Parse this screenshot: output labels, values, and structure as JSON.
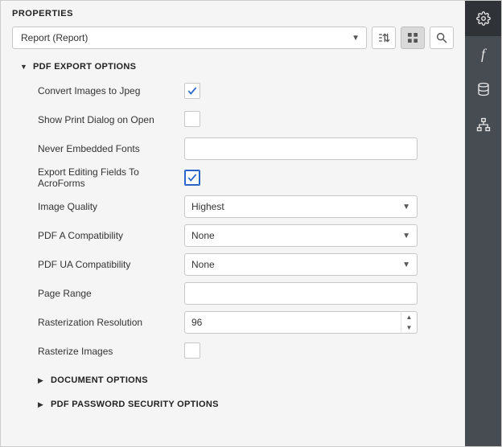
{
  "panel": {
    "title": "PROPERTIES"
  },
  "toolbar": {
    "selected_object": "Report (Report)"
  },
  "sections": {
    "pdf_export": {
      "title": "PDF EXPORT OPTIONS",
      "fields": {
        "convert_images_to_jpeg": {
          "label": "Convert Images to Jpeg",
          "checked": true
        },
        "show_print_dialog": {
          "label": "Show Print Dialog on Open",
          "checked": false
        },
        "never_embedded_fonts": {
          "label": "Never Embedded Fonts",
          "value": ""
        },
        "export_editing_fields": {
          "label": "Export Editing Fields To AcroForms",
          "checked": true
        },
        "image_quality": {
          "label": "Image Quality",
          "value": "Highest"
        },
        "pdf_a_compat": {
          "label": "PDF A Compatibility",
          "value": "None"
        },
        "pdf_ua_compat": {
          "label": "PDF UA Compatibility",
          "value": "None"
        },
        "page_range": {
          "label": "Page Range",
          "value": ""
        },
        "rasterization_resolution": {
          "label": "Rasterization Resolution",
          "value": "96"
        },
        "rasterize_images": {
          "label": "Rasterize Images",
          "checked": false
        }
      }
    },
    "document_options": {
      "title": "DOCUMENT OPTIONS"
    },
    "pdf_password_security": {
      "title": "PDF PASSWORD SECURITY OPTIONS"
    }
  }
}
